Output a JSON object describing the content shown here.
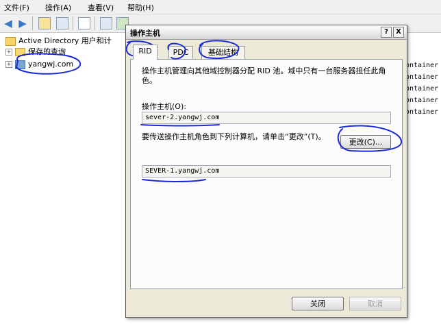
{
  "menubar": {
    "items": [
      {
        "label": "文件(F)"
      },
      {
        "label": "操作(A)"
      },
      {
        "label": "查看(V)"
      },
      {
        "label": "帮助(H)"
      }
    ]
  },
  "toolbar": {
    "back_icon": "back-arrow-icon",
    "forward_icon": "forward-arrow-icon"
  },
  "tree": {
    "root_label": "Active Directory 用户和计",
    "saved_queries_label": "保存的查询",
    "domain_label": "yangwj.com"
  },
  "right_pane": {
    "rows": [
      "ontainer",
      "ontainer",
      "ontainer",
      "ontainer",
      "ontainer"
    ]
  },
  "dialog": {
    "title": "操作主机",
    "help_btn": "?",
    "close_btn": "X",
    "tabs": [
      {
        "label": "RID",
        "active": true
      },
      {
        "label": "PDC",
        "active": false
      },
      {
        "label": "基础结构",
        "active": false
      }
    ],
    "description": "操作主机管理向其他域控制器分配 RID 池。域中只有一台服务器担任此角色。",
    "operations_master_label": "操作主机(O):",
    "operations_master_value": "sever-2.yangwj.com",
    "transfer_text": "要传送操作主机角色到下列计算机，请单击“更改”(T)。",
    "change_button": "更改(C)...",
    "target_computer_value": "SEVER-1.yangwj.com",
    "close_button": "关闭",
    "cancel_button": "取消"
  },
  "colors": {
    "annotation_ink": "#1c2ad6",
    "dialog_bg": "#ece9d8"
  }
}
